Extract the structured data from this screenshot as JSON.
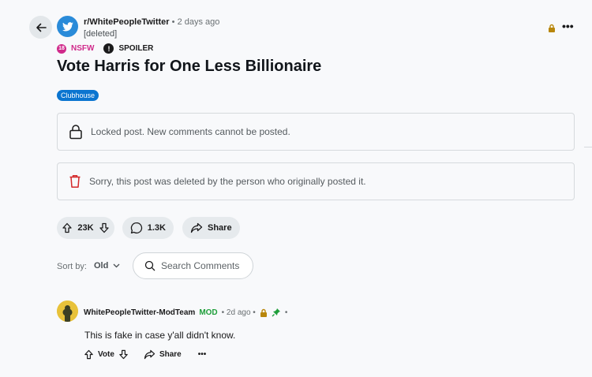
{
  "post": {
    "subreddit": "r/WhitePeopleTwitter",
    "time_ago": "• 2 days ago",
    "author": "[deleted]",
    "tags": {
      "nsfw_badge": "18",
      "nsfw": "NSFW",
      "spoiler_badge": "!",
      "spoiler": "SPOILER"
    },
    "title": "Vote Harris for One Less Billionaire",
    "flair": "Clubhouse",
    "locked_notice": "Locked post. New comments cannot be posted.",
    "deleted_notice": "Sorry, this post was deleted by the person who originally posted it.",
    "upvotes": "23K",
    "comments": "1.3K",
    "share_label": "Share",
    "more_label": "•••"
  },
  "sort": {
    "label": "Sort by:",
    "value": "Old"
  },
  "search": {
    "placeholder": "Search Comments"
  },
  "comment": {
    "author": "WhitePeopleTwitter-ModTeam",
    "mod_badge": "MOD",
    "time_ago": "• 2d ago •",
    "trailing_dot": "•",
    "body": "This is fake in case y'all didn't know.",
    "vote_label": "Vote",
    "share_label": "Share",
    "more_label": "•••"
  },
  "colors": {
    "accent": "#0b75d0",
    "nsfw": "#d02a8b",
    "mod": "#1e9e3a",
    "lock": "#b8860b",
    "delete": "#d4282a"
  }
}
